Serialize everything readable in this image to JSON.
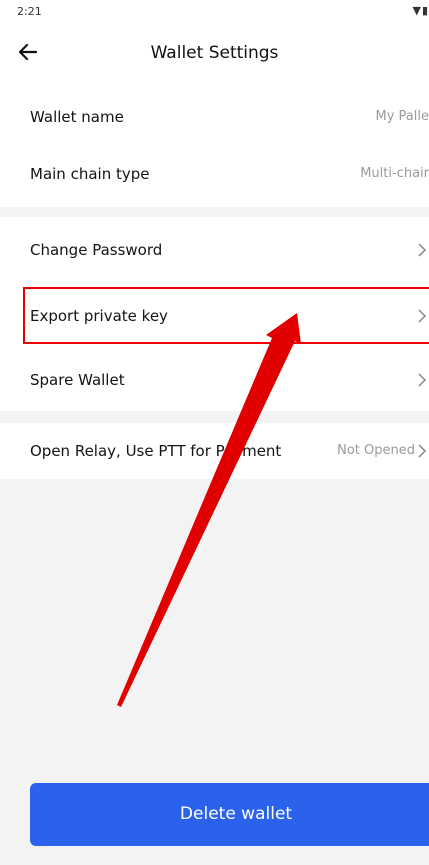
{
  "status": {
    "time": "2:21",
    "icons": "▼▮"
  },
  "header": {
    "title": "Wallet Settings",
    "back_icon": "back-arrow-icon"
  },
  "wallet_info": [
    {
      "label": "Wallet name",
      "value": "My Palle"
    },
    {
      "label": "Main chain type",
      "value": "Multi-chair"
    }
  ],
  "security": [
    {
      "label": "Change Password"
    },
    {
      "label": "Export private key"
    },
    {
      "label": "Spare Wallet"
    }
  ],
  "relay": {
    "label": "Open Relay, Use PTT for Payment",
    "value": "Not Opened"
  },
  "delete_button": {
    "label": "Delete wallet"
  },
  "colors": {
    "accent": "#2a62ec",
    "annotation": "#e00000",
    "background": "#f2f3f2"
  }
}
